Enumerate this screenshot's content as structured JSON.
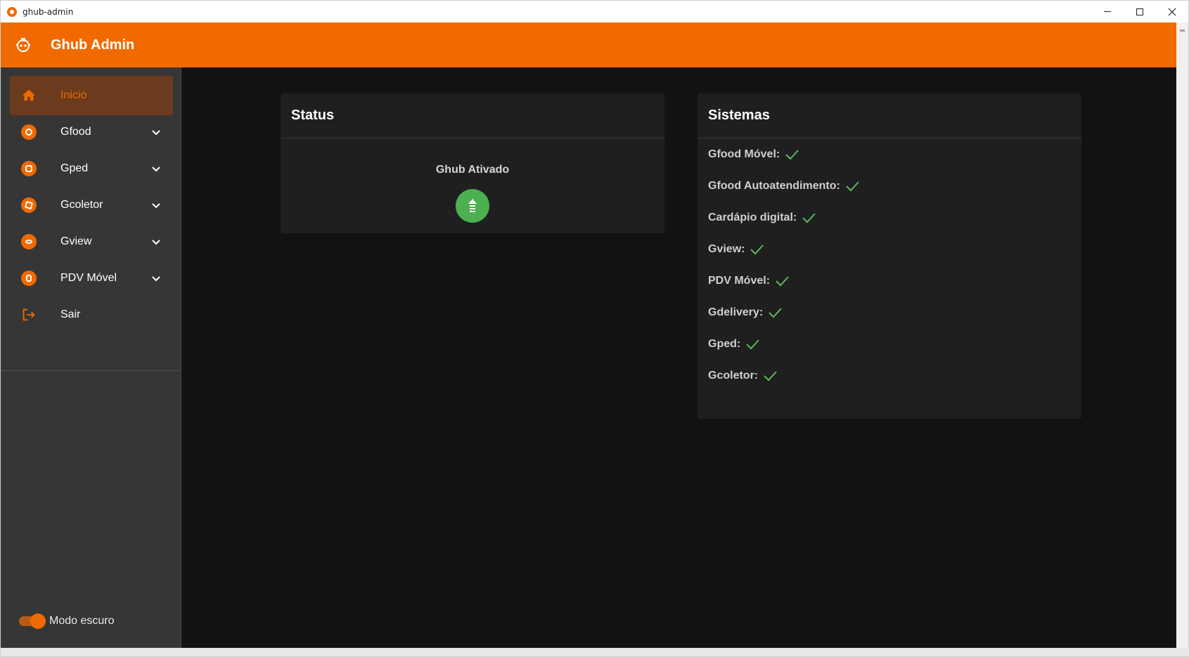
{
  "window": {
    "title": "ghub-admin"
  },
  "appbar": {
    "brand": "Ghub Admin"
  },
  "sidebar": {
    "items": [
      {
        "label": "Inicio",
        "icon": "home-icon",
        "active": true,
        "expandable": false
      },
      {
        "label": "Gfood",
        "icon": "gfood-icon",
        "active": false,
        "expandable": true
      },
      {
        "label": "Gped",
        "icon": "gped-icon",
        "active": false,
        "expandable": true
      },
      {
        "label": "Gcoletor",
        "icon": "gcoletor-icon",
        "active": false,
        "expandable": true
      },
      {
        "label": "Gview",
        "icon": "gview-icon",
        "active": false,
        "expandable": true
      },
      {
        "label": "PDV Móvel",
        "icon": "pdv-movel-icon",
        "active": false,
        "expandable": true
      },
      {
        "label": "Sair",
        "icon": "logout-icon",
        "active": false,
        "expandable": false
      }
    ],
    "dark_mode_label": "Modo escuro",
    "dark_mode_on": true
  },
  "status_card": {
    "title": "Status",
    "status_text": "Ghub Ativado"
  },
  "systems_card": {
    "title": "Sistemas",
    "items": [
      {
        "label": "Gfood Móvel:",
        "ok": true
      },
      {
        "label": "Gfood Autoatendimento:",
        "ok": true
      },
      {
        "label": "Cardápio digital:",
        "ok": true
      },
      {
        "label": "Gview:",
        "ok": true
      },
      {
        "label": "PDV Móvel:",
        "ok": true
      },
      {
        "label": "Gdelivery:",
        "ok": true
      },
      {
        "label": "Gped:",
        "ok": true
      },
      {
        "label": "Gcoletor:",
        "ok": true
      }
    ]
  },
  "colors": {
    "accent": "#f06a00",
    "sidebar_bg": "#363636",
    "main_bg": "#121212",
    "card_bg": "#1f1f1f",
    "success": "#4caf50",
    "check": "#5cb85c"
  }
}
